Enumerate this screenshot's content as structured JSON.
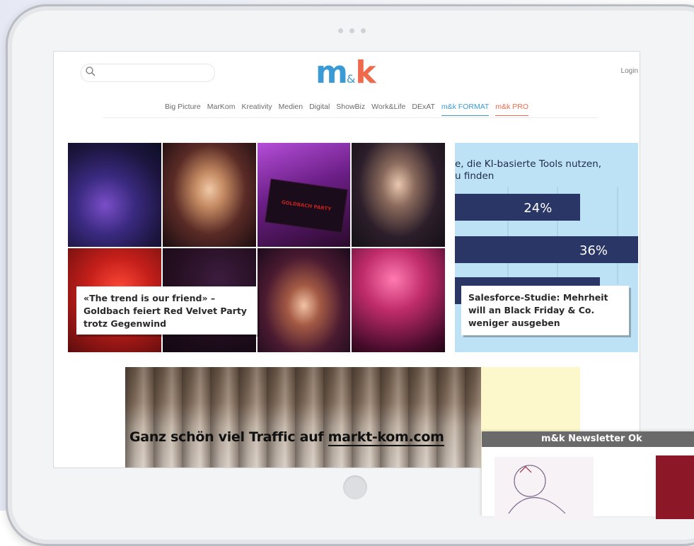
{
  "header": {
    "search_placeholder": "",
    "logo": {
      "m": "m",
      "amp": "&",
      "k": "k"
    },
    "login_label": "Login"
  },
  "nav": {
    "items": [
      {
        "label": "Big Picture",
        "style": "default"
      },
      {
        "label": "MarKom",
        "style": "default"
      },
      {
        "label": "Kreativity",
        "style": "default"
      },
      {
        "label": "Medien",
        "style": "default"
      },
      {
        "label": "Digital",
        "style": "default"
      },
      {
        "label": "ShowBiz",
        "style": "default"
      },
      {
        "label": "Work&Life",
        "style": "default"
      },
      {
        "label": "DExAT",
        "style": "default"
      },
      {
        "label": "m&k FORMAT",
        "style": "blue"
      },
      {
        "label": "m&k PRO",
        "style": "red"
      }
    ]
  },
  "hero": {
    "left_caption": "«The trend is our friend» – Goldbach feiert Red Velvet Party trotz Gegenwind",
    "sign_text": "GOLDBACH PARTY",
    "right_caption": "Salesforce-Studie: Mehrheit will an Black Friday & Co. weniger ausgeben"
  },
  "chart_data": {
    "type": "bar",
    "title_line1": "e, die KI-basierte Tools nutzen,",
    "title_line2": "u finden",
    "values": [
      24,
      36
    ],
    "value_labels": [
      "24%",
      "36%"
    ],
    "bar_color": "#2a3766",
    "background": "#bde2f5"
  },
  "banner": {
    "text_prefix": "Ganz schön viel Traffic auf ",
    "text_link": "markt-kom.com"
  },
  "newsletter": {
    "brand": "m&k",
    "title": "Newsletter Ok"
  },
  "colors": {
    "brand_blue": "#3a9ad6",
    "brand_red": "#ef6a4c"
  }
}
